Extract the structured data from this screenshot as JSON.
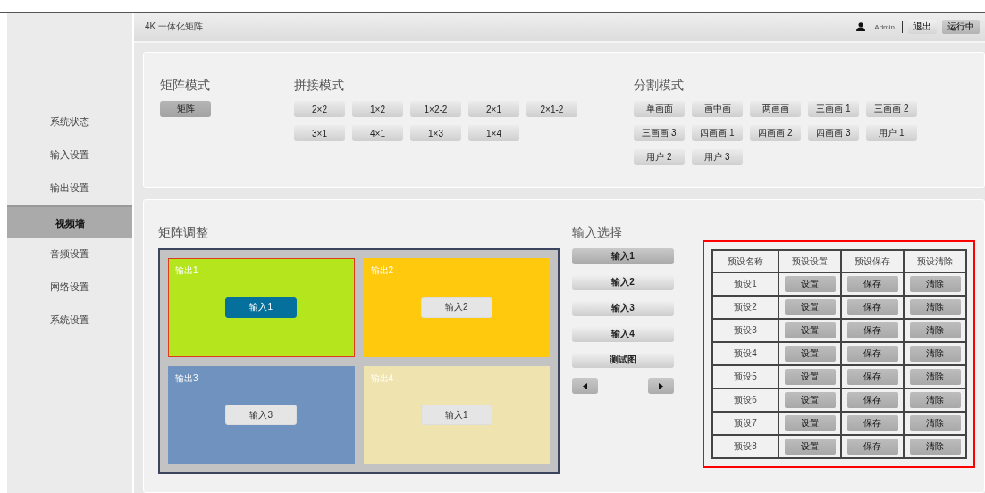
{
  "header": {
    "title": "4K 一体化矩阵",
    "user": "Admin",
    "buttons": [
      {
        "label": "退出",
        "selected": false
      },
      {
        "label": "运行中",
        "selected": true
      }
    ]
  },
  "sidebar": {
    "items": [
      {
        "label": "系统状态",
        "selected": false
      },
      {
        "label": "输入设置",
        "selected": false
      },
      {
        "label": "输出设置",
        "selected": false
      },
      {
        "label": "视频墙",
        "selected": true
      },
      {
        "label": "音频设置",
        "selected": false
      },
      {
        "label": "网络设置",
        "selected": false
      },
      {
        "label": "系统设置",
        "selected": false
      }
    ]
  },
  "modes": [
    {
      "title": "矩阵模式",
      "buttons": [
        {
          "label": "矩阵",
          "selected": true
        }
      ]
    },
    {
      "title": "拼接模式",
      "buttons": [
        {
          "label": "2×2",
          "selected": false
        },
        {
          "label": "1×2",
          "selected": false
        },
        {
          "label": "1×2-2",
          "selected": false
        },
        {
          "label": "2×1",
          "selected": false
        },
        {
          "label": "2×1-2",
          "selected": false
        },
        {
          "label": "3×1",
          "selected": false
        },
        {
          "label": "4×1",
          "selected": false
        },
        {
          "label": "1×3",
          "selected": false
        },
        {
          "label": "1×4",
          "selected": false
        }
      ]
    },
    {
      "title": "分割模式",
      "buttons": [
        {
          "label": "单画面",
          "selected": false
        },
        {
          "label": "画中画",
          "selected": false
        },
        {
          "label": "两画画",
          "selected": false
        },
        {
          "label": "三画画 1",
          "selected": false
        },
        {
          "label": "三画画 2",
          "selected": false
        },
        {
          "label": "三画画 3",
          "selected": false
        },
        {
          "label": "四画画 1",
          "selected": false
        },
        {
          "label": "四画画 2",
          "selected": false
        },
        {
          "label": "四画画 3",
          "selected": false
        },
        {
          "label": "用户 1",
          "selected": false
        },
        {
          "label": "用户 2",
          "selected": false
        },
        {
          "label": "用户 3",
          "selected": false
        }
      ]
    }
  ],
  "matrix_adjust": {
    "title": "矩阵调整",
    "cells": [
      {
        "label": "输出1",
        "color": "#b5e61d",
        "selected": true,
        "input": {
          "label": "输入1",
          "selected": true
        }
      },
      {
        "label": "输出2",
        "color": "#ffc90e",
        "selected": false,
        "input": {
          "label": "输入2",
          "selected": false
        }
      },
      {
        "label": "输出3",
        "color": "#7092be",
        "selected": false,
        "input": {
          "label": "输入3",
          "selected": false
        }
      },
      {
        "label": "输出4",
        "color": "#efe4b0",
        "selected": false,
        "input": {
          "label": "输入1",
          "selected": false
        }
      }
    ]
  },
  "input_select": {
    "title": "输入选择",
    "buttons": [
      {
        "label": "输入1",
        "selected": true
      },
      {
        "label": "输入2",
        "selected": false
      },
      {
        "label": "输入3",
        "selected": false
      },
      {
        "label": "输入4",
        "selected": false
      },
      {
        "label": "测试图",
        "selected": false
      }
    ]
  },
  "presets": {
    "columns": [
      "预设名称",
      "预设设置",
      "预设保存",
      "预设清除"
    ],
    "rows": [
      {
        "name": "预设1",
        "buttons": [
          "设置",
          "保存",
          "清除"
        ]
      },
      {
        "name": "预设2",
        "buttons": [
          "设置",
          "保存",
          "清除"
        ]
      },
      {
        "name": "预设3",
        "buttons": [
          "设置",
          "保存",
          "清除"
        ]
      },
      {
        "name": "预设4",
        "buttons": [
          "设置",
          "保存",
          "清除"
        ]
      },
      {
        "name": "预设5",
        "buttons": [
          "设置",
          "保存",
          "清除"
        ]
      },
      {
        "name": "预设6",
        "buttons": [
          "设置",
          "保存",
          "清除"
        ]
      },
      {
        "name": "预设7",
        "buttons": [
          "设置",
          "保存",
          "清除"
        ]
      },
      {
        "name": "预设8",
        "buttons": [
          "设置",
          "保存",
          "清除"
        ]
      }
    ]
  }
}
